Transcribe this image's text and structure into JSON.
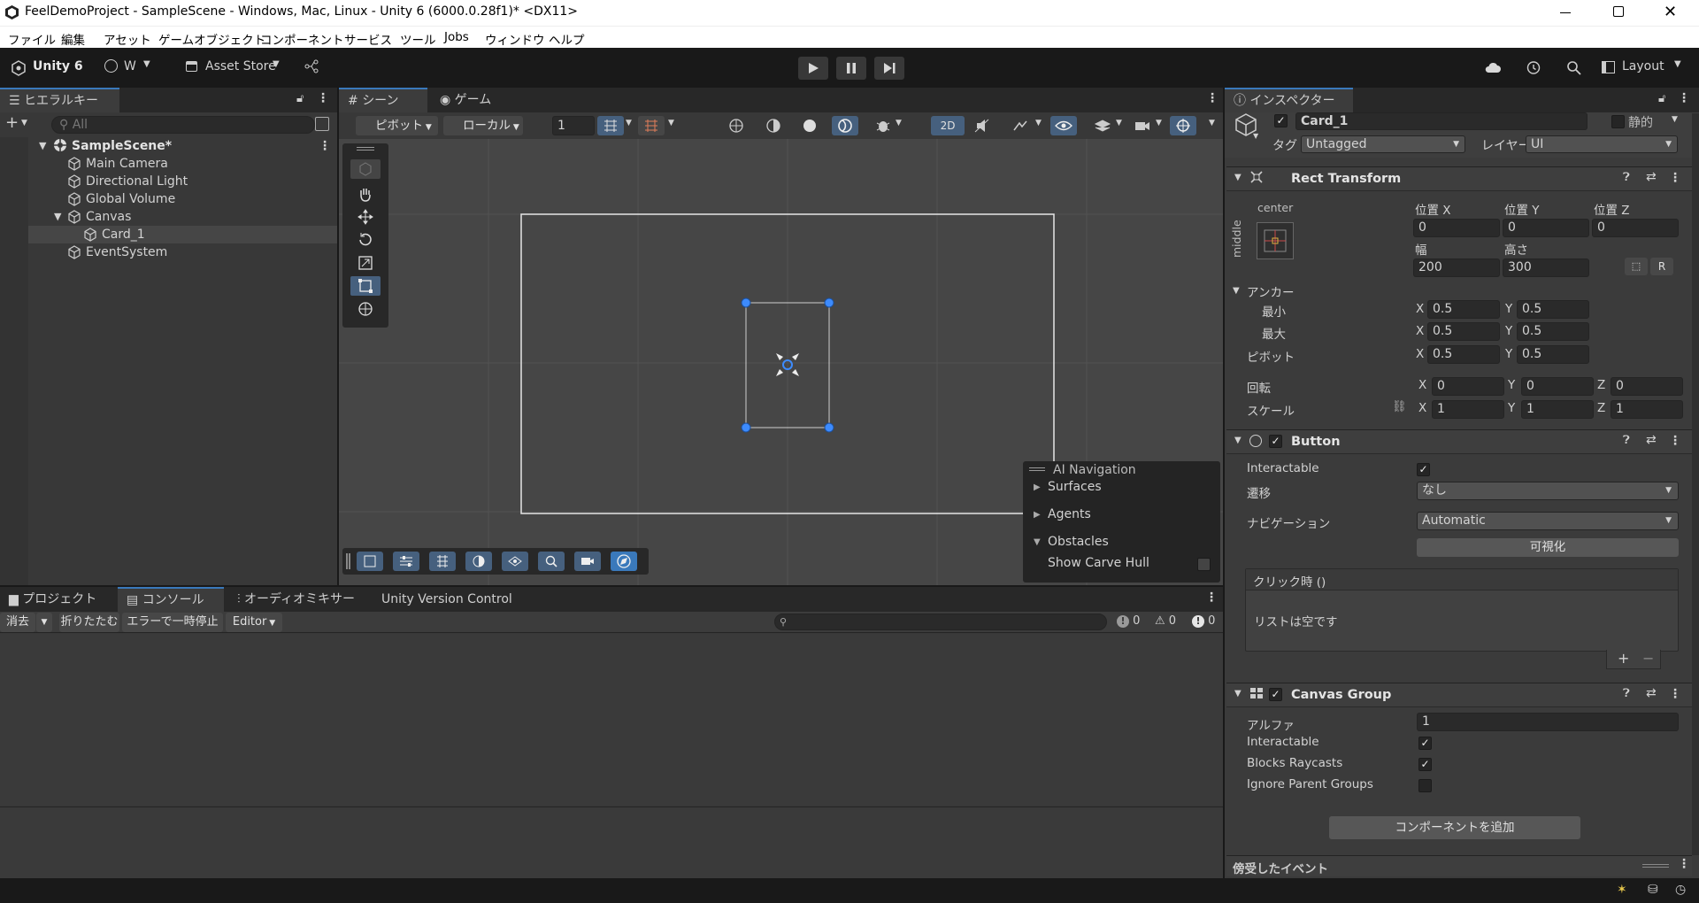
{
  "window": {
    "title": "FeelDemoProject - SampleScene - Windows, Mac, Linux - Unity 6 (6000.0.28f1)* <DX11>"
  },
  "menu": [
    "ファイル",
    "編集",
    "アセット",
    "ゲームオブジェクト",
    "コンポーネント",
    "サービス",
    "ツール",
    "Jobs",
    "ウィンドウ",
    "ヘルプ"
  ],
  "toolbar": {
    "unity_label": "Unity 6",
    "account_label": "W",
    "asset_store_label": "Asset Store",
    "layout_label": "Layout"
  },
  "hierarchy": {
    "tab": "ヒエラルキー",
    "search_placeholder": "All",
    "scene": "SampleScene*",
    "items": [
      {
        "label": "Main Camera"
      },
      {
        "label": "Directional Light"
      },
      {
        "label": "Global Volume"
      },
      {
        "label": "Canvas"
      },
      {
        "label": "Card_1"
      },
      {
        "label": "EventSystem"
      }
    ]
  },
  "scene_view": {
    "tabs": [
      "シーン",
      "ゲーム"
    ],
    "pivot_label": "ピボット",
    "local_label": "ローカル",
    "grid_value": "1",
    "mode_2d": "2D",
    "overlay": {
      "title": "AI Navigation",
      "items": [
        "Surfaces",
        "Agents",
        "Obstacles"
      ],
      "show_carve_hull": "Show Carve Hull"
    }
  },
  "bottom": {
    "tabs": [
      "プロジェクト",
      "コンソール",
      "オーディオミキサー",
      "Unity Version Control"
    ],
    "buttons": {
      "clear": "消去",
      "collapse": "折りたたむ",
      "error_pause": "エラーで一時停止",
      "editor": "Editor"
    },
    "counts": {
      "log": "0",
      "warn": "0",
      "error": "0"
    }
  },
  "inspector": {
    "tab": "インスペクター",
    "object_name": "Card_1",
    "static_label": "静的",
    "tag_label": "タグ",
    "tag_value": "Untagged",
    "layer_label": "レイヤー",
    "layer_value": "UI",
    "rect_transform": {
      "title": "Rect Transform",
      "anchor_h": "center",
      "anchor_v": "middle",
      "pos_x_label": "位置 X",
      "pos_y_label": "位置 Y",
      "pos_z_label": "位置 Z",
      "pos_x": "0",
      "pos_y": "0",
      "pos_z": "0",
      "width_label": "幅",
      "height_label": "高さ",
      "width": "200",
      "height": "300",
      "r_button": "R",
      "anchors_label": "アンカー",
      "min_label": "最小",
      "max_label": "最大",
      "pivot_label": "ピボット",
      "min_x": "0.5",
      "min_y": "0.5",
      "max_x": "0.5",
      "max_y": "0.5",
      "pivot_x": "0.5",
      "pivot_y": "0.5",
      "rotation_label": "回転",
      "rot_x": "0",
      "rot_y": "0",
      "rot_z": "0",
      "scale_label": "スケール",
      "scale_x": "1",
      "scale_y": "1",
      "scale_z": "1",
      "axis_x": "X",
      "axis_y": "Y",
      "axis_z": "Z"
    },
    "button": {
      "title": "Button",
      "interactable_label": "Interactable",
      "transition_label": "遷移",
      "transition_value": "なし",
      "navigation_label": "ナビゲーション",
      "navigation_value": "Automatic",
      "visualize": "可視化",
      "onclick": "クリック時 ()",
      "list_empty": "リストは空です"
    },
    "canvas_group": {
      "title": "Canvas Group",
      "alpha_label": "アルファ",
      "alpha": "1",
      "interactable_label": "Interactable",
      "blocks_raycasts_label": "Blocks Raycasts",
      "ignore_parent_label": "Ignore Parent Groups"
    },
    "add_component": "コンポーネントを追加",
    "intercepted_events": "傍受したイベント"
  },
  "colors": {
    "accent": "#3a79bb",
    "panel": "#383838",
    "dark": "#191919",
    "handle": "#3d8bfd"
  }
}
